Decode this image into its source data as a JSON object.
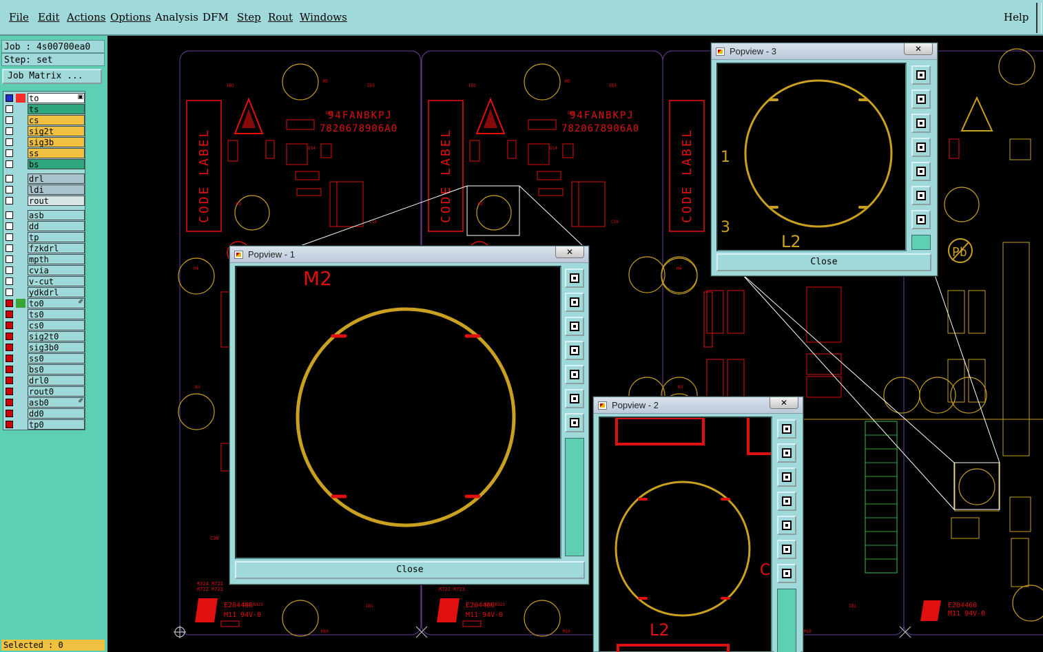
{
  "menu": {
    "file": "File",
    "edit": "Edit",
    "actions": "Actions",
    "options": "Options",
    "analysis": "Analysis",
    "dfm": "DFM",
    "step": "Step",
    "rout": "Rout",
    "windows": "Windows",
    "help": "Help"
  },
  "left_panel": {
    "job": "Job : 4s00700ea0",
    "step": "Step: set",
    "job_matrix_button": "Job Matrix ...",
    "layers": [
      {
        "name": "to",
        "checked": "blue",
        "color": "#ff2a2a",
        "bg": "#ffffff"
      },
      {
        "name": "ts",
        "checked": "off",
        "color": "",
        "bg": "#2ea67e"
      },
      {
        "name": "cs",
        "checked": "off",
        "color": "",
        "bg": "#f0c040"
      },
      {
        "name": "sig2t",
        "checked": "off",
        "color": "",
        "bg": "#f0c040"
      },
      {
        "name": "sig3b",
        "checked": "off",
        "color": "",
        "bg": "#f0c040"
      },
      {
        "name": "ss",
        "checked": "off",
        "color": "",
        "bg": "#f0c040"
      },
      {
        "name": "bs",
        "checked": "off",
        "color": "",
        "bg": "#2ea67e"
      },
      {
        "name": "drl",
        "checked": "off",
        "color": "",
        "bg": "#a9c3cc"
      },
      {
        "name": "ldi",
        "checked": "off",
        "color": "",
        "bg": "#a9c3cc"
      },
      {
        "name": "rout",
        "checked": "off",
        "color": "",
        "bg": "#d6e6e6"
      },
      {
        "name": "asb",
        "checked": "off",
        "color": "",
        "bg": "#9fd9d9"
      },
      {
        "name": "dd",
        "checked": "off",
        "color": "",
        "bg": "#9fd9d9"
      },
      {
        "name": "tp",
        "checked": "off",
        "color": "",
        "bg": "#9fd9d9"
      },
      {
        "name": "fzkdrl",
        "checked": "off",
        "color": "",
        "bg": "#9fd9d9"
      },
      {
        "name": "mpth",
        "checked": "off",
        "color": "",
        "bg": "#9fd9d9"
      },
      {
        "name": "cvia",
        "checked": "off",
        "color": "",
        "bg": "#9fd9d9"
      },
      {
        "name": "v-cut",
        "checked": "off",
        "color": "",
        "bg": "#9fd9d9"
      },
      {
        "name": "ydkdrl",
        "checked": "off",
        "color": "",
        "bg": "#9fd9d9"
      },
      {
        "name": "to0",
        "checked": "red",
        "color": "#3aa535",
        "bg": "#9fd9d9"
      },
      {
        "name": "ts0",
        "checked": "red",
        "color": "",
        "bg": "#9fd9d9"
      },
      {
        "name": "cs0",
        "checked": "red",
        "color": "",
        "bg": "#9fd9d9"
      },
      {
        "name": "sig2t0",
        "checked": "red",
        "color": "",
        "bg": "#9fd9d9"
      },
      {
        "name": "sig3b0",
        "checked": "red",
        "color": "",
        "bg": "#9fd9d9"
      },
      {
        "name": "ss0",
        "checked": "red",
        "color": "",
        "bg": "#9fd9d9"
      },
      {
        "name": "bs0",
        "checked": "red",
        "color": "",
        "bg": "#9fd9d9"
      },
      {
        "name": "drl0",
        "checked": "red",
        "color": "",
        "bg": "#9fd9d9"
      },
      {
        "name": "rout0",
        "checked": "red",
        "color": "",
        "bg": "#9fd9d9"
      },
      {
        "name": "asb0",
        "checked": "red",
        "color": "",
        "bg": "#9fd9d9"
      },
      {
        "name": "dd0",
        "checked": "red",
        "color": "",
        "bg": "#9fd9d9"
      },
      {
        "name": "tp0",
        "checked": "red",
        "color": "",
        "bg": "#9fd9d9"
      }
    ],
    "selected": "Selected : 0"
  },
  "board": {
    "code_label": "CODE LABEL",
    "mark_line1": "94FANBKPJ",
    "mark_line2": "7820678906A0",
    "ul_line1": "E204460",
    "ul_line2": "M11 94V-0",
    "pb": "Pb",
    "refs": [
      "ID2",
      "M5",
      "ID3",
      "GND",
      "U14",
      "M2",
      "C18",
      "M4",
      "M6",
      "TP4",
      "TP5",
      "L1",
      "M3",
      "C863",
      "C850",
      "M9",
      "C3",
      "C4",
      "C880",
      "C2",
      "P2",
      "C11",
      "C12",
      "ID1",
      "M10",
      "VCC3V3",
      "C15 R323",
      "PL3"
    ]
  },
  "popups": [
    {
      "title": "Popview - 1",
      "close_button": "Close",
      "label": "M2"
    },
    {
      "title": "Popview - 2",
      "close_button": "Close",
      "label": "L2",
      "side_label": "C"
    },
    {
      "title": "Popview - 3",
      "close_button": "Close",
      "label": "L2",
      "side_labels": [
        "1",
        "3"
      ]
    }
  ],
  "colors": {
    "menu_bg": "#9fd9d9",
    "panel_bg": "#5fcfb3",
    "outline": "#7a3aa0",
    "silk_red": "#e01010",
    "pad_gold": "#c9a020",
    "green_part": "#30a040"
  }
}
